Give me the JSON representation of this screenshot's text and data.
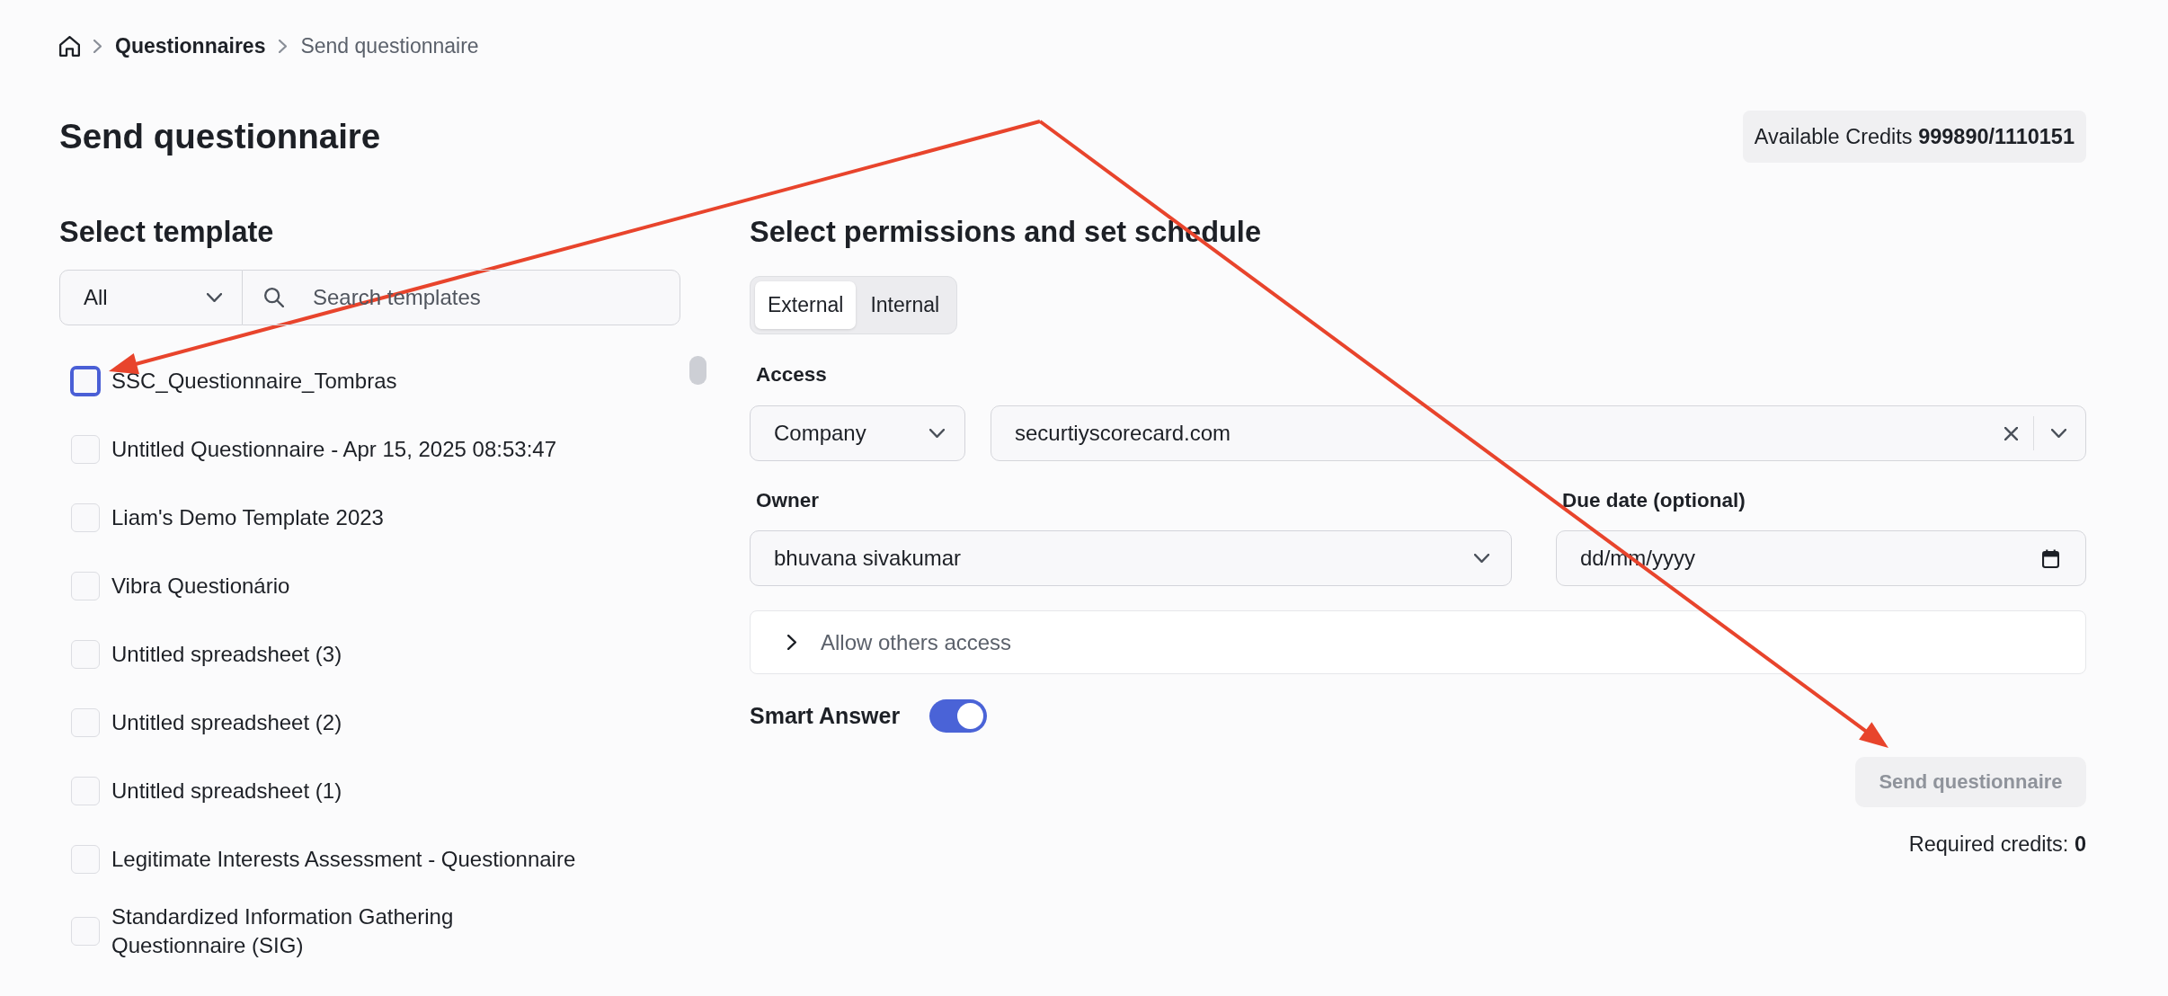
{
  "breadcrumb": [
    {
      "kind": "home"
    },
    {
      "kind": "link",
      "label": "Questionnaires"
    },
    {
      "kind": "current",
      "label": "Send questionnaire"
    }
  ],
  "page_title": "Send questionnaire",
  "credits_badge": {
    "text": "Available Credits **999890/1110151**"
  },
  "template_panel": {
    "heading": "Select template",
    "category_filter": {
      "value": "All"
    },
    "search": {
      "placeholder": "Search templates"
    },
    "templates": [
      {
        "name": "SSC_Questionnaire_Tombras",
        "checked": false,
        "focused": true
      },
      {
        "name": "Untitled Questionnaire - Apr 15, 2025 08:53:47",
        "checked": false,
        "focused": false
      },
      {
        "name": "Liam's Demo Template 2023",
        "checked": false,
        "focused": false
      },
      {
        "name": "Vibra Questionário",
        "checked": false,
        "focused": false
      },
      {
        "name": "Untitled spreadsheet (3)",
        "checked": false,
        "focused": false
      },
      {
        "name": "Untitled spreadsheet (2)",
        "checked": false,
        "focused": false
      },
      {
        "name": "Untitled spreadsheet (1)",
        "checked": false,
        "focused": false
      },
      {
        "name": "Legitimate Interests Assessment - Questionnaire",
        "checked": false,
        "focused": false
      },
      {
        "name": "Standardized Information Gathering Questionnaire (SIG)",
        "checked": false,
        "focused": false
      }
    ]
  },
  "permissions_panel": {
    "heading": "Select permissions and set schedule",
    "audience_tabs": [
      {
        "label": "External",
        "selected": true
      },
      {
        "label": "Internal",
        "selected": false
      }
    ],
    "access": {
      "label": "Access",
      "type": {
        "value": "Company"
      },
      "domain": {
        "value": "securtiyscorecard.com"
      }
    },
    "owner": {
      "label": "Owner",
      "value": "bhuvana sivakumar"
    },
    "due_date": {
      "label": "Due date (optional)",
      "placeholder": "dd/mm/yyyy"
    },
    "allow_others": {
      "label": "Allow others access",
      "expanded": false
    },
    "smart_answer": {
      "label": "Smart Answer",
      "on": true
    },
    "send_button": {
      "label": "Send questionnaire",
      "disabled": true
    },
    "required_credits": {
      "text": "Required credits: **0**"
    }
  },
  "annotations": [
    {
      "kind": "arrow"
    },
    {
      "kind": "arrow"
    }
  ]
}
